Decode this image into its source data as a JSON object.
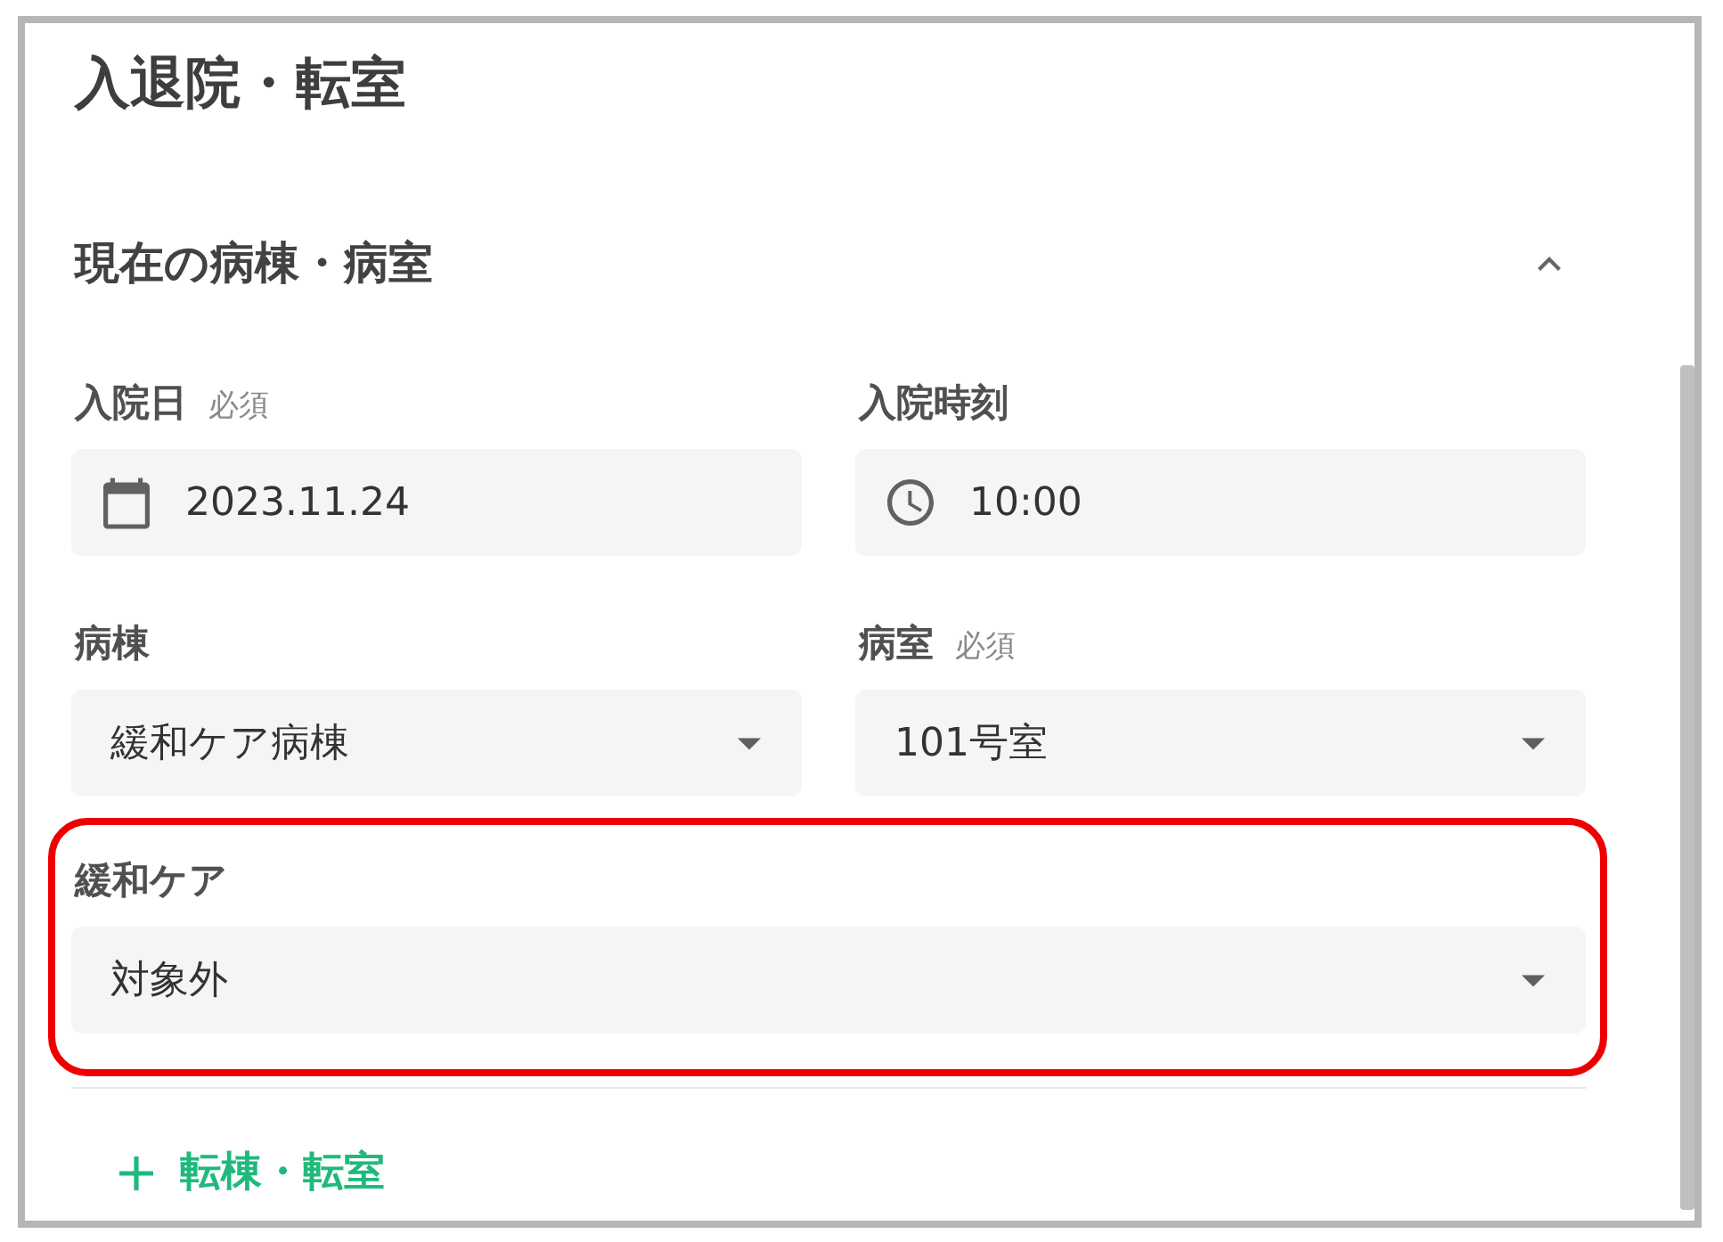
{
  "page": {
    "title": "入退院・転室"
  },
  "section": {
    "title": "現在の病棟・病室",
    "expanded": true
  },
  "rows": [
    {
      "fields": [
        {
          "label": "入院日",
          "required_tag": "必須",
          "kind": "date",
          "value": "2023.11.24",
          "highlighted": false
        },
        {
          "label": "入院時刻",
          "kind": "time",
          "value": "10:00",
          "highlighted": false
        }
      ]
    },
    {
      "fields": [
        {
          "label": "病棟",
          "kind": "select",
          "value": "緩和ケア病棟",
          "highlighted": false
        },
        {
          "label": "病室",
          "required_tag": "必須",
          "kind": "select",
          "value": "101号室",
          "highlighted": false
        }
      ]
    },
    {
      "fields": [
        {
          "label": "緩和ケア",
          "kind": "select",
          "value": "対象外",
          "highlighted": true
        }
      ]
    }
  ],
  "add_button": {
    "label": "転棟・転室"
  }
}
